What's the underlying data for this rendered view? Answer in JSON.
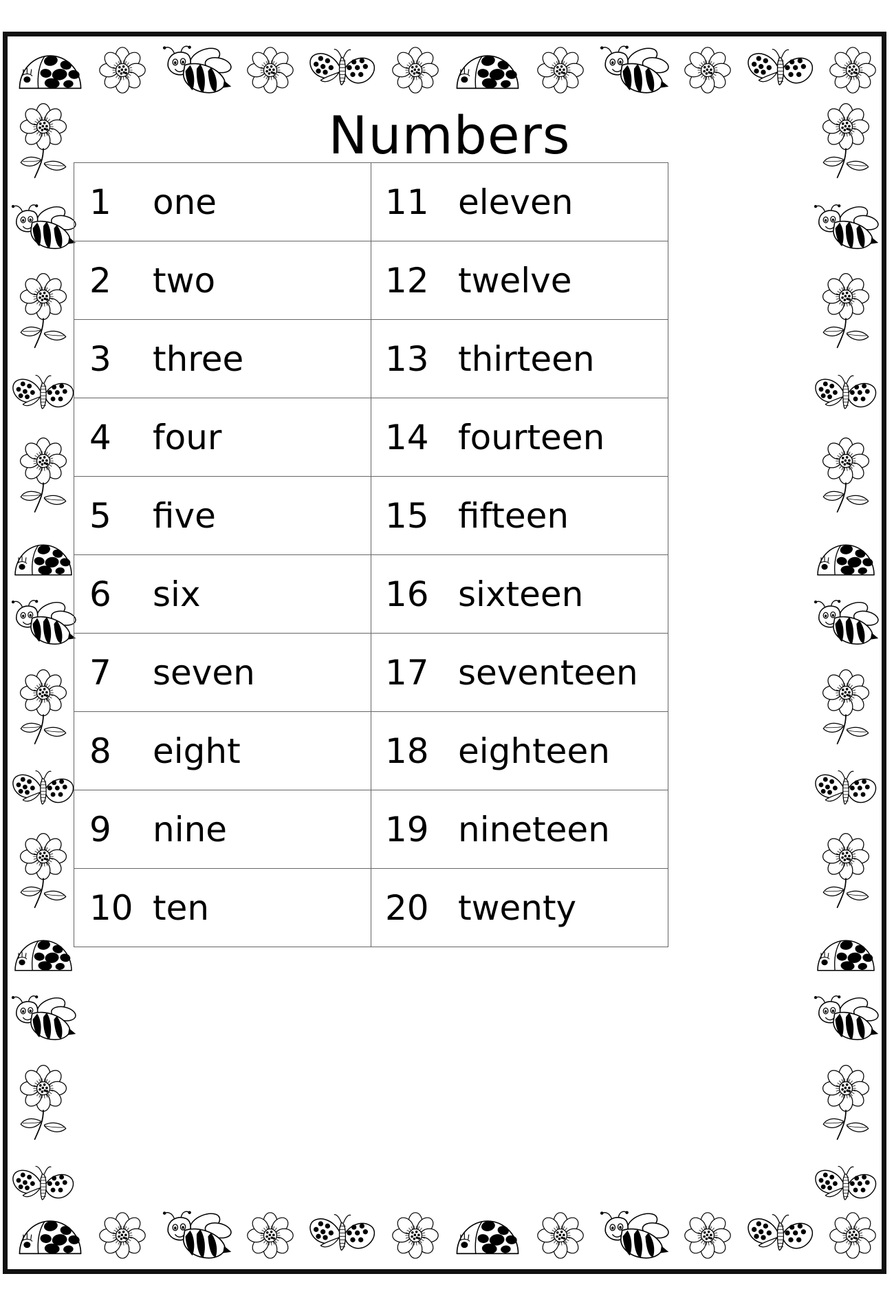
{
  "page": {
    "title": "Numbers",
    "background_color": "#ffffff",
    "ink_color": "#000000",
    "frame_color": "#111111",
    "grid_color": "#666666"
  },
  "table": {
    "columns": 2,
    "rows": 10,
    "left_column": [
      {
        "numeral": "1",
        "word": "one"
      },
      {
        "numeral": "2",
        "word": "two"
      },
      {
        "numeral": "3",
        "word": "three"
      },
      {
        "numeral": "4",
        "word": "four"
      },
      {
        "numeral": "5",
        "word": "five"
      },
      {
        "numeral": "6",
        "word": "six"
      },
      {
        "numeral": "7",
        "word": "seven"
      },
      {
        "numeral": "8",
        "word": "eight"
      },
      {
        "numeral": "9",
        "word": "nine"
      },
      {
        "numeral": "10",
        "word": "ten"
      }
    ],
    "right_column": [
      {
        "numeral": "11",
        "word": "eleven"
      },
      {
        "numeral": "12",
        "word": "twelve"
      },
      {
        "numeral": "13",
        "word": "thirteen"
      },
      {
        "numeral": "14",
        "word": "fourteen"
      },
      {
        "numeral": "15",
        "word": "fifteen"
      },
      {
        "numeral": "16",
        "word": "sixteen"
      },
      {
        "numeral": "17",
        "word": "seventeen"
      },
      {
        "numeral": "18",
        "word": "eighteen"
      },
      {
        "numeral": "19",
        "word": "nineteen"
      },
      {
        "numeral": "20",
        "word": "twenty"
      }
    ]
  },
  "decorations": {
    "top_sequence": [
      "ladybug-icon",
      "flower-icon",
      "bee-icon",
      "flower-icon",
      "butterfly-icon",
      "flower-icon",
      "ladybug-icon",
      "flower-icon",
      "bee-icon",
      "flower-icon",
      "butterfly-icon",
      "flower-icon"
    ],
    "bottom_sequence": [
      "ladybug-icon",
      "flower-icon",
      "bee-icon",
      "flower-icon",
      "butterfly-icon",
      "flower-icon",
      "ladybug-icon",
      "flower-icon",
      "bee-icon",
      "flower-icon",
      "butterfly-icon",
      "flower-icon"
    ],
    "left_sequence": [
      "flower-stem-icon",
      "bee-icon",
      "flower-stem-icon",
      "butterfly-icon",
      "flower-stem-icon",
      "ladybug-icon",
      "bee-icon",
      "flower-stem-icon",
      "butterfly-icon",
      "flower-stem-icon",
      "ladybug-icon",
      "bee-icon",
      "flower-stem-icon",
      "butterfly-icon"
    ],
    "right_sequence": [
      "flower-stem-icon",
      "bee-icon",
      "flower-stem-icon",
      "butterfly-icon",
      "flower-stem-icon",
      "ladybug-icon",
      "bee-icon",
      "flower-stem-icon",
      "butterfly-icon",
      "flower-stem-icon",
      "ladybug-icon",
      "bee-icon",
      "flower-stem-icon",
      "butterfly-icon"
    ]
  }
}
